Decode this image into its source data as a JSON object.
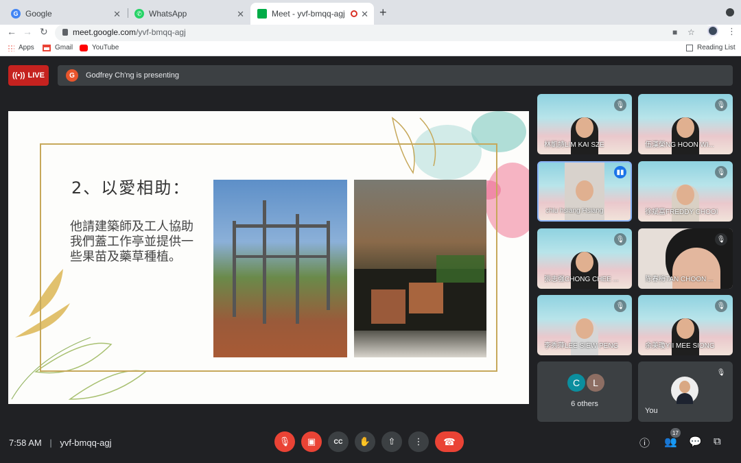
{
  "tabs": [
    {
      "label": "Google"
    },
    {
      "label": "WhatsApp"
    },
    {
      "label": "Meet - yvf-bmqq-agj"
    }
  ],
  "address": {
    "host": "meet.google.com",
    "path": "/yvf-bmqq-agj"
  },
  "bookmarks": [
    {
      "label": "Apps"
    },
    {
      "label": "Gmail"
    },
    {
      "label": "YouTube"
    }
  ],
  "reading_list": "Reading List",
  "meet": {
    "live_label": "LIVE",
    "presenter_initial": "G",
    "presenting_text": "Godfrey Ch'ng is presenting",
    "slide": {
      "title": "2、以愛相助：",
      "body": "他請建築師及工人協助我們蓋工作亭並提供一些果苗及藥草種植。"
    },
    "participants": [
      {
        "name": "林凱詩LIM KAI SZE",
        "state": "muted"
      },
      {
        "name": "伍漢榮NG HOON WI...",
        "state": "muted"
      },
      {
        "name": "chiu hsiang Hsiang",
        "state": "speaking"
      },
      {
        "name": "徐斌富FREDDY CHOOI",
        "state": "muted"
      },
      {
        "name": "張志强CHONG CHEE ...",
        "state": "muted"
      },
      {
        "name": "陈春梅TAN CHOON ...",
        "state": "muted"
      },
      {
        "name": "李秀萍LEE SIEW PENG",
        "state": "muted"
      },
      {
        "name": "余美瓊YII MEE SIONG",
        "state": "muted"
      }
    ],
    "others": {
      "chips": [
        "C",
        "L"
      ],
      "label": "6 others"
    },
    "self_label": "You",
    "time": "7:58 AM",
    "meeting_code": "yvf-bmqq-agj",
    "participant_count": "17"
  }
}
